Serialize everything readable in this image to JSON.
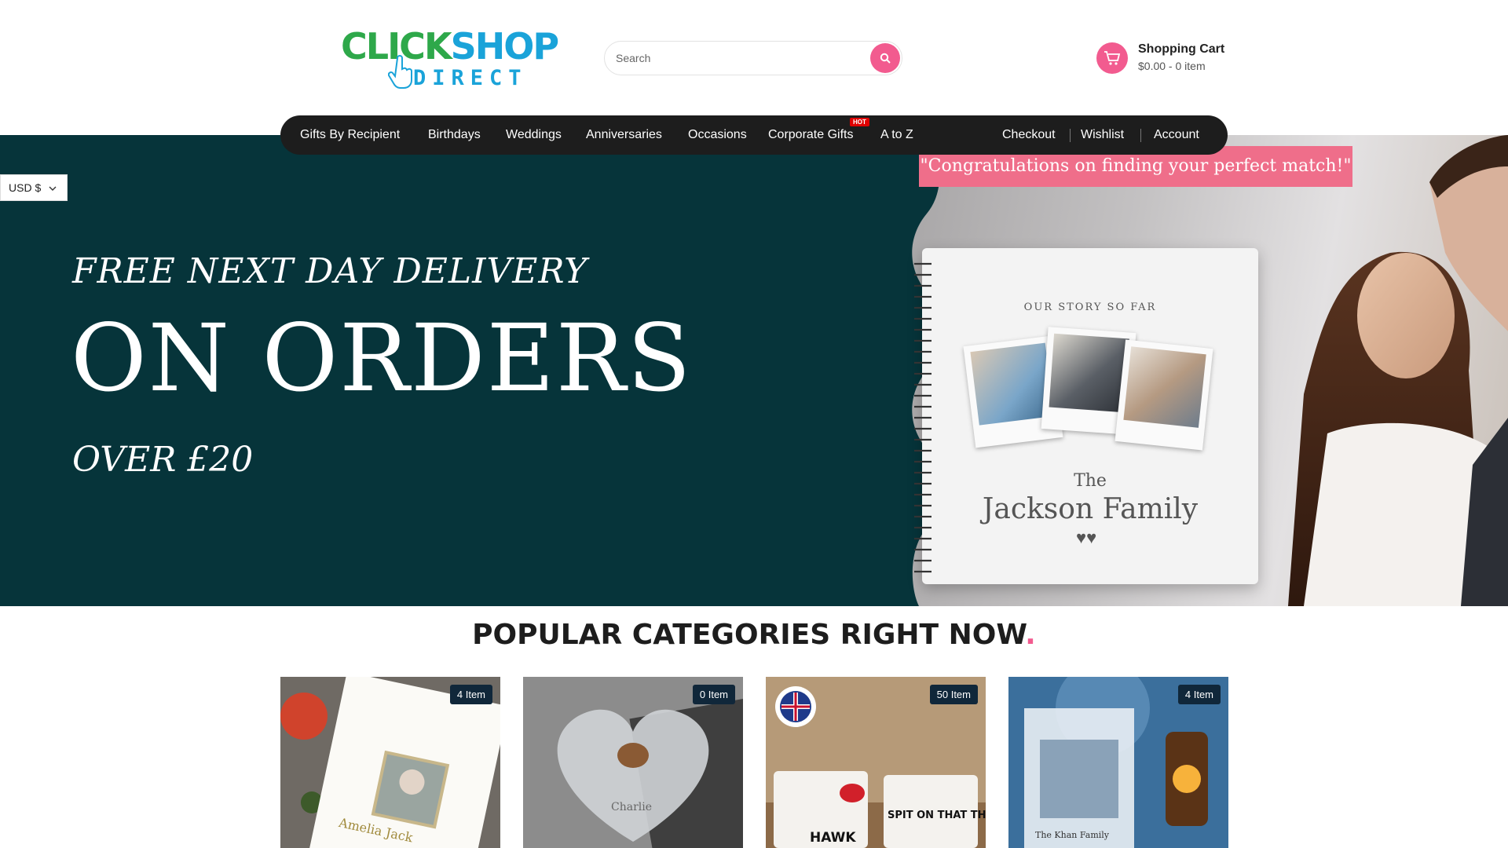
{
  "header": {
    "logo": {
      "top": "CLICKSHOP",
      "bottom": "DIRECT"
    },
    "search": {
      "placeholder": "Search"
    },
    "cart": {
      "title": "Shopping Cart",
      "summary": "$0.00 - 0 item"
    }
  },
  "nav": {
    "items": [
      {
        "label": "Gifts By Recipient"
      },
      {
        "label": "Birthdays"
      },
      {
        "label": "Weddings"
      },
      {
        "label": "Anniversaries"
      },
      {
        "label": "Occasions"
      },
      {
        "label": "Corporate Gifts",
        "badge": "HOT"
      },
      {
        "label": "A to Z"
      }
    ],
    "right_items": [
      {
        "label": "Checkout"
      },
      {
        "label": "Wishlist"
      },
      {
        "label": "Account"
      }
    ]
  },
  "currency": {
    "selected": "USD $"
  },
  "banner": {
    "line1": "FREE NEXT DAY DELIVERY",
    "line2": "ON ORDERS",
    "line3": "OVER £20",
    "congrats": "\"Congratulations on finding your perfect match!\"",
    "notebook": {
      "kicker": "OUR STORY SO FAR",
      "the": "The",
      "name": "Jackson Family"
    }
  },
  "categories": {
    "title": "POPULAR CATEGORIES RIGHT NOW",
    "title_dot": ".",
    "cards": [
      {
        "badge": "4 Item",
        "art_text": "Amelia Jack"
      },
      {
        "badge": "0 Item",
        "art_text": "Charlie"
      },
      {
        "badge": "50 Item",
        "art_text_left": "HAWK",
        "art_text_right": "SPIT ON THAT THING"
      },
      {
        "badge": "4 Item",
        "art_text": "The Khan Family"
      }
    ]
  },
  "colors": {
    "accent": "#f25b8f",
    "banner_bg": "#06343a",
    "nav_bg": "#1d1d1d",
    "badge_bg": "#10273a",
    "logo_green": "#2ea84a",
    "logo_blue": "#1aa3d9"
  }
}
